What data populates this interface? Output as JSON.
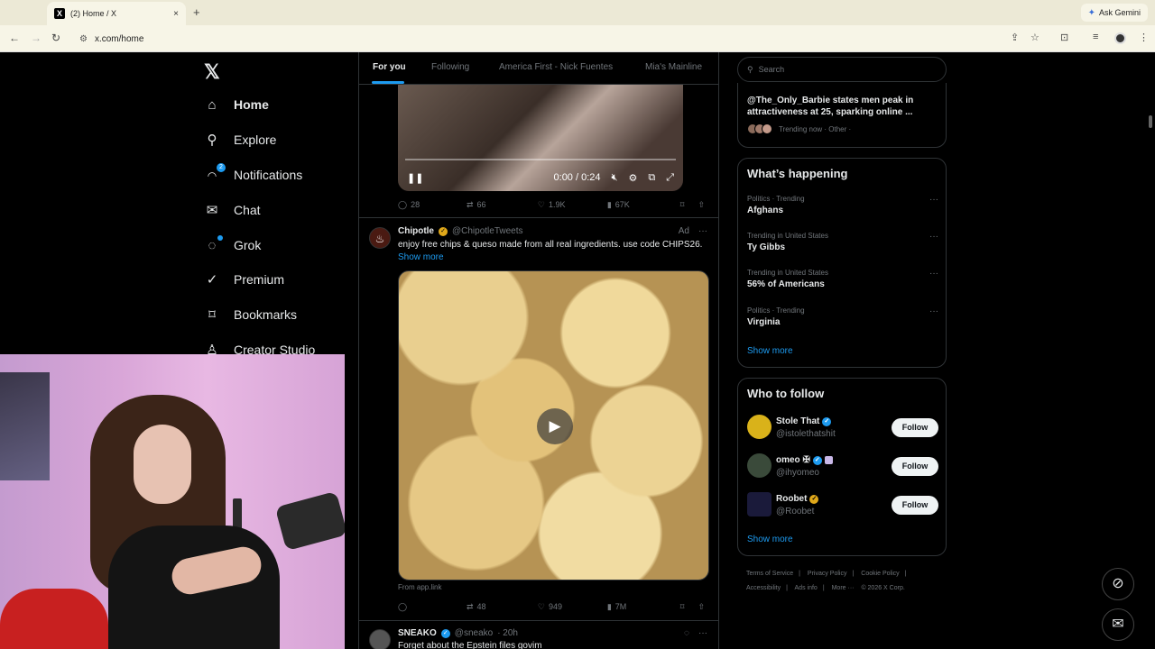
{
  "browser": {
    "tab_title": "(2) Home / X",
    "tab_favicon": "X",
    "new_tab": "+",
    "close_tab": "×",
    "ask_gemini": "Ask Gemini",
    "url": "x.com/home"
  },
  "sidebar": {
    "logo": "𝕏",
    "notifications_badge": "2",
    "items": [
      {
        "label": "Home",
        "icon": "home-icon",
        "glyph": "⌂"
      },
      {
        "label": "Explore",
        "icon": "search-icon",
        "glyph": "⚲"
      },
      {
        "label": "Notifications",
        "icon": "bell-icon",
        "glyph": "🔔"
      },
      {
        "label": "Chat",
        "icon": "mail-icon",
        "glyph": "✉"
      },
      {
        "label": "Grok",
        "icon": "grok-icon",
        "glyph": "◌"
      },
      {
        "label": "Premium",
        "icon": "premium-icon",
        "glyph": "✓"
      },
      {
        "label": "Bookmarks",
        "icon": "bookmark-icon",
        "glyph": "⌑"
      },
      {
        "label": "Creator Studio",
        "icon": "creator-studio-icon",
        "glyph": "♙"
      }
    ]
  },
  "feed": {
    "tabs": [
      "For you",
      "Following",
      "America First - Nick Fuentes",
      "Mia's Mainline"
    ],
    "video1": {
      "time": "0:00 / 0:24",
      "stats": {
        "replies": "28",
        "reposts": "66",
        "likes": "1.9K",
        "views": "67K"
      }
    },
    "ad_post": {
      "name": "Chipotle",
      "handle": "@ChipotleTweets",
      "ad_label": "Ad",
      "more": "···",
      "text": "enjoy free chips & queso made from all real ingredients. use code CHIPS26.",
      "show_more": "Show more",
      "from": "From app.link",
      "stats": {
        "reposts": "48",
        "likes": "949",
        "views": "7M"
      }
    },
    "next_post": {
      "name": "SNEAKO",
      "handle": "@sneako",
      "time": "· 20h",
      "text": "Forget about the Epstein files govim"
    }
  },
  "right": {
    "search_placeholder": "Search",
    "top_trend": {
      "text": "@The_Only_Barbie states men peak in attractiveness at 25, sparking online ...",
      "meta": "Trending now · Other ·"
    },
    "whats_happening": {
      "title": "What’s happening",
      "trends": [
        {
          "context": "Politics · Trending",
          "name": "Afghans"
        },
        {
          "context": "Trending in United States",
          "name": "Ty Gibbs"
        },
        {
          "context": "Trending in United States",
          "name": "56% of Americans"
        },
        {
          "context": "Politics · Trending",
          "name": "Virginia"
        }
      ],
      "show_more": "Show more",
      "more_glyph": "···"
    },
    "who_to_follow": {
      "title": "Who to follow",
      "accounts": [
        {
          "name": "Stole That",
          "handle": "@istolethatshit",
          "follow": "Follow",
          "color": "#d9b21a"
        },
        {
          "name": "omeo ✠",
          "handle": "@ihyomeo",
          "follow": "Follow",
          "color": "#3a4a3a"
        },
        {
          "name": "Roobet",
          "handle": "@Roobet",
          "follow": "Follow",
          "color": "#1a1a3a"
        }
      ],
      "show_more": "Show more"
    },
    "footer": [
      "Terms of Service",
      "|",
      "Privacy Policy",
      "|",
      "Cookie Policy",
      "|",
      "Accessibility",
      "|",
      "Ads info",
      "|",
      "More ···",
      "© 2026 X Corp."
    ]
  }
}
